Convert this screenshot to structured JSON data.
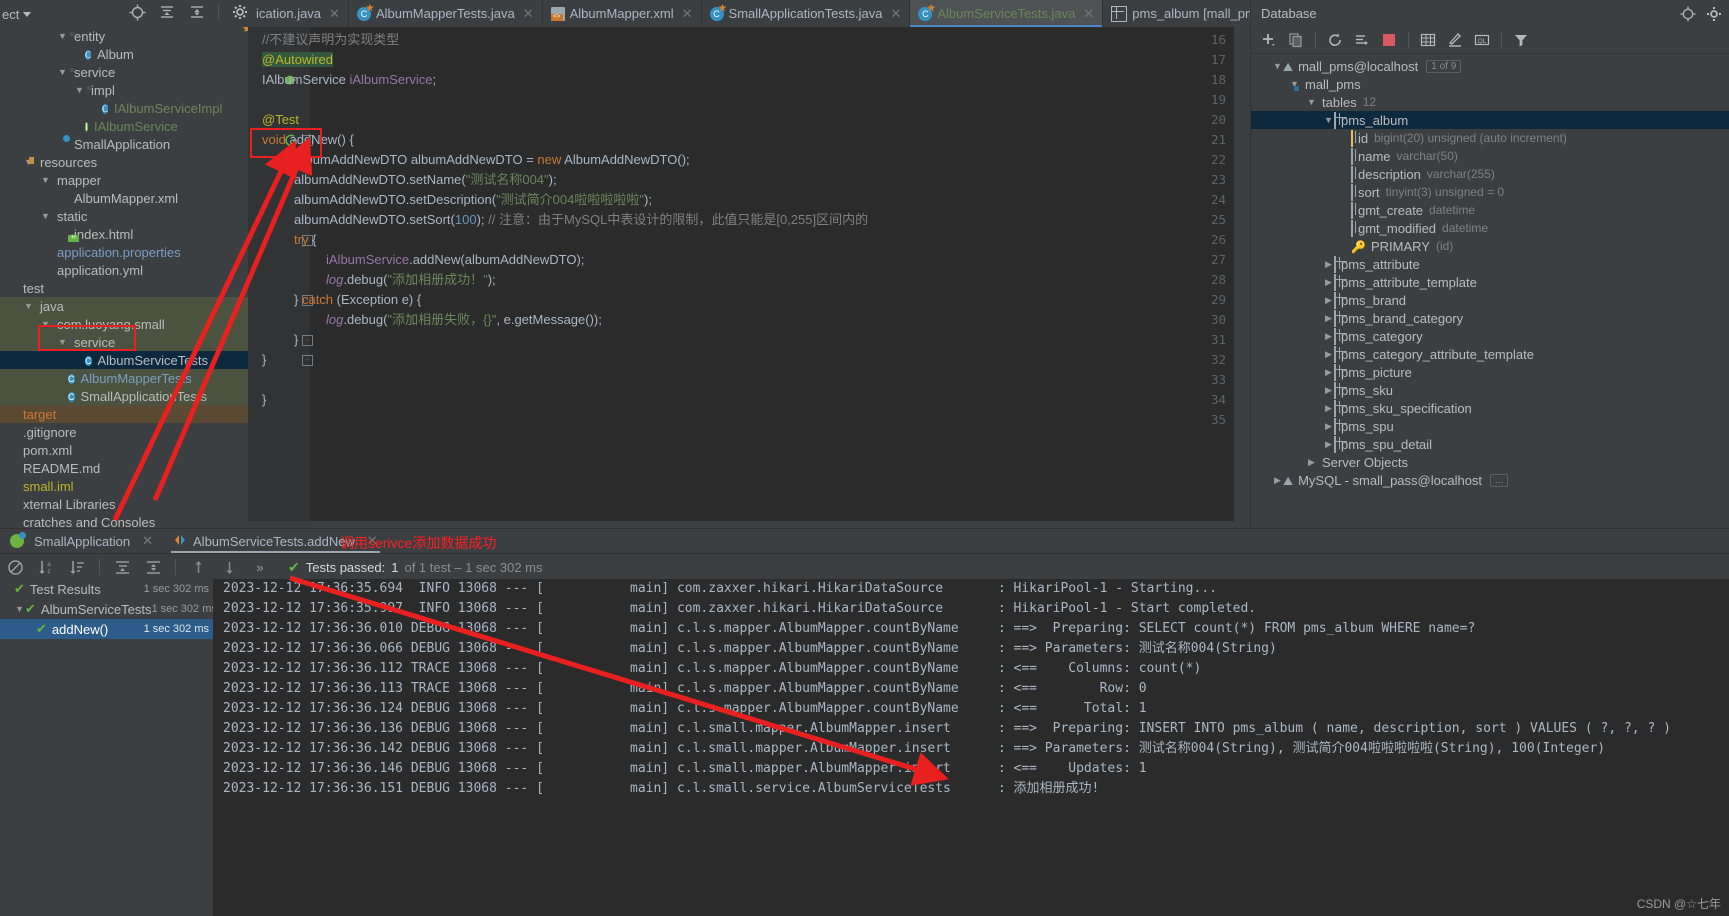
{
  "toolbar": {
    "project_label": "ect",
    "icons": [
      "locate-icon",
      "collapse-all-icon",
      "expand-all-icon",
      "gear-icon",
      "minimize-icon"
    ]
  },
  "editor_tabs": [
    {
      "label": "ication.java",
      "icon": "java-class-icon",
      "active": false,
      "color": "grey"
    },
    {
      "label": "AlbumMapperTests.java",
      "icon": "test-class-icon",
      "active": false,
      "color": "grey"
    },
    {
      "label": "AlbumMapper.xml",
      "icon": "xml-file-icon",
      "active": false,
      "color": "grey"
    },
    {
      "label": "SmallApplicationTests.java",
      "icon": "test-class-icon",
      "active": false,
      "color": "grey"
    },
    {
      "label": "AlbumServiceTests.java",
      "icon": "test-class-icon",
      "active": true,
      "color": "green"
    },
    {
      "label": "pms_album [mall_pms@localhost]",
      "icon": "db-table-icon",
      "active": false,
      "color": "grey"
    }
  ],
  "project_tree": [
    {
      "label": "entity",
      "indent": 3,
      "icon": "package-icon",
      "arrow": "down",
      "state": "normal",
      "clipped": true
    },
    {
      "label": "Album",
      "indent": 4,
      "icon": "class-icon",
      "arrow": "",
      "state": "normal"
    },
    {
      "label": "service",
      "indent": 3,
      "icon": "package-icon",
      "arrow": "down",
      "state": "normal"
    },
    {
      "label": "impl",
      "indent": 4,
      "icon": "package-icon",
      "arrow": "down",
      "state": "normal"
    },
    {
      "label": "IAlbumServiceImpl",
      "indent": 5,
      "icon": "class-icon",
      "arrow": "",
      "state": "green"
    },
    {
      "label": "IAlbumService",
      "indent": 4,
      "icon": "interface-icon",
      "arrow": "",
      "state": "green"
    },
    {
      "label": "SmallApplication",
      "indent": 3,
      "icon": "spring-icon",
      "arrow": "",
      "state": "normal"
    },
    {
      "label": "resources",
      "indent": 1,
      "icon": "resources-folder-icon",
      "arrow": "down",
      "state": "normal"
    },
    {
      "label": "mapper",
      "indent": 2,
      "icon": "folder-icon",
      "arrow": "down",
      "state": "normal"
    },
    {
      "label": "AlbumMapper.xml",
      "indent": 3,
      "icon": "xml-file-icon",
      "arrow": "",
      "state": "normal"
    },
    {
      "label": "static",
      "indent": 2,
      "icon": "folder-icon",
      "arrow": "down",
      "state": "normal"
    },
    {
      "label": "index.html",
      "indent": 3,
      "icon": "html-file-icon",
      "arrow": "",
      "state": "normal"
    },
    {
      "label": "application.properties",
      "indent": 2,
      "icon": "properties-icon",
      "arrow": "",
      "state": "blue"
    },
    {
      "label": "application.yml",
      "indent": 2,
      "icon": "properties-icon",
      "arrow": "",
      "state": "normal"
    },
    {
      "label": "test",
      "indent": 0,
      "icon": "folder-icon",
      "arrow": "",
      "state": "normal"
    },
    {
      "label": "java",
      "indent": 1,
      "icon": "test-source-folder-icon",
      "arrow": "down",
      "state": "testsrc"
    },
    {
      "label": "com.luoyang.small",
      "indent": 2,
      "icon": "package-icon",
      "arrow": "down",
      "state": "testsrc"
    },
    {
      "label": "service",
      "indent": 3,
      "icon": "package-icon",
      "arrow": "down",
      "state": "testsrc"
    },
    {
      "label": "AlbumServiceTests",
      "indent": 4,
      "icon": "test-class-icon",
      "arrow": "",
      "state": "selected"
    },
    {
      "label": "AlbumMapperTests",
      "indent": 3,
      "icon": "test-class-icon",
      "arrow": "",
      "state": "testsrc-blue"
    },
    {
      "label": "SmallApplicationTests",
      "indent": 3,
      "icon": "test-class-icon",
      "arrow": "",
      "state": "testsrc"
    },
    {
      "label": "target",
      "indent": 0,
      "icon": "target-folder-icon",
      "arrow": "",
      "state": "target"
    },
    {
      "label": ".gitignore",
      "indent": 0,
      "icon": "git-file-icon",
      "arrow": "",
      "state": "normal"
    },
    {
      "label": "pom.xml",
      "indent": 0,
      "icon": "maven-icon",
      "arrow": "",
      "state": "normal"
    },
    {
      "label": "README.md",
      "indent": 0,
      "icon": "markdown-icon",
      "arrow": "",
      "state": "normal"
    },
    {
      "label": "small.iml",
      "indent": 0,
      "icon": "iml-icon",
      "arrow": "",
      "state": "yellow"
    },
    {
      "label": "xternal Libraries",
      "indent": -1,
      "icon": "library-icon",
      "arrow": "",
      "state": "normal"
    },
    {
      "label": "cratches and Consoles",
      "indent": -1,
      "icon": "scratch-icon",
      "arrow": "",
      "state": "normal"
    }
  ],
  "editor": {
    "warning_count": "1",
    "warning_icon": "warning-triangle-icon",
    "first_line_number": 16,
    "lines": [
      {
        "n": 16,
        "html": "<span class='cmt'>//不建议声明为实现类型</span>",
        "indent": 0
      },
      {
        "n": 17,
        "html": "<span class='ann ann-hl'>@Autowired</span>",
        "indent": 0,
        "bulb": true,
        "caret": true
      },
      {
        "n": 18,
        "html": "<span class='typ'>IAlbumService</span> <span class='fld'>iAlbumService</span><span class='pln'>;</span>",
        "indent": 0,
        "impl_marker": true
      },
      {
        "n": 19,
        "html": "",
        "indent": 0
      },
      {
        "n": 20,
        "html": "<span class='ann'>@Test</span>",
        "indent": 0
      },
      {
        "n": 21,
        "html": "<span class='kw'>void</span> <span class='pln'>addNew() {</span>",
        "indent": 0,
        "run_marker": true,
        "fold": true
      },
      {
        "n": 22,
        "html": "<span class='typ'>AlbumAddNewDTO</span> <span class='pln'>albumAddNewDTO = </span><span class='kw'>new</span> <span class='typ'>AlbumAddNewDTO</span><span class='pln'>();</span>",
        "indent": 1
      },
      {
        "n": 23,
        "html": "<span class='pln'>albumAddNewDTO.setName(</span><span class='str'>\"测试名称004\"</span><span class='pln'>);</span>",
        "indent": 1
      },
      {
        "n": 24,
        "html": "<span class='pln'>albumAddNewDTO.setDescription(</span><span class='str'>\"测试简介004啦啦啦啦啦\"</span><span class='pln'>);</span>",
        "indent": 1
      },
      {
        "n": 25,
        "html": "<span class='pln'>albumAddNewDTO.setSort(</span><span class='num'>100</span><span class='pln'>);</span> <span class='cmt'>// 注意：由于MySQL中表设计的限制，此值只能是[0,255]区间内的</span>",
        "indent": 1
      },
      {
        "n": 26,
        "html": "<span class='kw'>try</span> <span class='pln'>{</span>",
        "indent": 1,
        "fold": true
      },
      {
        "n": 27,
        "html": "<span class='fld'>iAlbumService</span><span class='pln'>.addNew(albumAddNewDTO);</span>",
        "indent": 2
      },
      {
        "n": 28,
        "html": "<span class='ital'>log</span><span class='pln'>.debug(</span><span class='str'>\"添加相册成功！\"</span><span class='pln'>);</span>",
        "indent": 2
      },
      {
        "n": 29,
        "html": "<span class='pln'>} </span><span class='kw'>catch</span> <span class='pln'>(Exception e) {</span>",
        "indent": 1,
        "fold": true
      },
      {
        "n": 30,
        "html": "<span class='ital'>log</span><span class='pln'>.debug(</span><span class='str'>\"添加相册失败，{}\"</span><span class='pln'>, e.getMessage());</span>",
        "indent": 2
      },
      {
        "n": 31,
        "html": "<span class='pln'>}</span>",
        "indent": 1,
        "fold": true
      },
      {
        "n": 32,
        "html": "<span class='pln'>}</span>",
        "indent": 0,
        "fold": true
      },
      {
        "n": 33,
        "html": "",
        "indent": 0
      },
      {
        "n": 34,
        "html": "<span class='pln'>}</span>",
        "indent": -1
      },
      {
        "n": 35,
        "html": "",
        "indent": 0
      }
    ]
  },
  "database": {
    "title": "Database",
    "header_icons": [
      "locate-icon",
      "settings-icon"
    ],
    "toolbar_icons": [
      "add-icon",
      "copy-icon",
      "refresh-icon",
      "sync-icon",
      "stop-icon",
      "table-icon",
      "modify-icon",
      "sql-console-icon",
      "filter-icon"
    ],
    "tree": [
      {
        "label": "mall_pms@localhost",
        "type": "",
        "indent": 1,
        "icon": "connection-icon",
        "arrow": "down",
        "badge": "1 of 9",
        "state": "normal"
      },
      {
        "label": "mall_pms",
        "type": "",
        "indent": 2,
        "icon": "schema-icon",
        "arrow": "down",
        "state": "normal"
      },
      {
        "label": "tables",
        "type": "12",
        "indent": 3,
        "icon": "folder-icon",
        "arrow": "down",
        "state": "normal"
      },
      {
        "label": "pms_album",
        "type": "",
        "indent": 4,
        "icon": "table-icon",
        "arrow": "down",
        "state": "selected"
      },
      {
        "label": "id",
        "type": "bigint(20) unsigned (auto increment)",
        "indent": 5,
        "icon": "pk-column-icon",
        "arrow": "",
        "state": "normal"
      },
      {
        "label": "name",
        "type": "varchar(50)",
        "indent": 5,
        "icon": "column-icon",
        "arrow": "",
        "state": "normal"
      },
      {
        "label": "description",
        "type": "varchar(255)",
        "indent": 5,
        "icon": "column-icon",
        "arrow": "",
        "state": "normal"
      },
      {
        "label": "sort",
        "type": "tinyint(3) unsigned = 0",
        "indent": 5,
        "icon": "column-icon",
        "arrow": "",
        "state": "normal"
      },
      {
        "label": "gmt_create",
        "type": "datetime",
        "indent": 5,
        "icon": "column-icon",
        "arrow": "",
        "state": "normal"
      },
      {
        "label": "gmt_modified",
        "type": "datetime",
        "indent": 5,
        "icon": "column-icon",
        "arrow": "",
        "state": "normal"
      },
      {
        "label": "PRIMARY",
        "type": "(id)",
        "indent": 5,
        "icon": "key-icon",
        "arrow": "",
        "state": "normal"
      },
      {
        "label": "pms_attribute",
        "type": "",
        "indent": 4,
        "icon": "table-icon",
        "arrow": "right",
        "state": "normal"
      },
      {
        "label": "pms_attribute_template",
        "type": "",
        "indent": 4,
        "icon": "table-icon",
        "arrow": "right",
        "state": "normal"
      },
      {
        "label": "pms_brand",
        "type": "",
        "indent": 4,
        "icon": "table-icon",
        "arrow": "right",
        "state": "normal"
      },
      {
        "label": "pms_brand_category",
        "type": "",
        "indent": 4,
        "icon": "table-icon",
        "arrow": "right",
        "state": "normal"
      },
      {
        "label": "pms_category",
        "type": "",
        "indent": 4,
        "icon": "table-icon",
        "arrow": "right",
        "state": "normal"
      },
      {
        "label": "pms_category_attribute_template",
        "type": "",
        "indent": 4,
        "icon": "table-icon",
        "arrow": "right",
        "state": "normal"
      },
      {
        "label": "pms_picture",
        "type": "",
        "indent": 4,
        "icon": "table-icon",
        "arrow": "right",
        "state": "normal"
      },
      {
        "label": "pms_sku",
        "type": "",
        "indent": 4,
        "icon": "table-icon",
        "arrow": "right",
        "state": "normal"
      },
      {
        "label": "pms_sku_specification",
        "type": "",
        "indent": 4,
        "icon": "table-icon",
        "arrow": "right",
        "state": "normal"
      },
      {
        "label": "pms_spu",
        "type": "",
        "indent": 4,
        "icon": "table-icon",
        "arrow": "right",
        "state": "normal"
      },
      {
        "label": "pms_spu_detail",
        "type": "",
        "indent": 4,
        "icon": "table-icon",
        "arrow": "right",
        "state": "normal"
      },
      {
        "label": "Server Objects",
        "type": "",
        "indent": 3,
        "icon": "folder-icon",
        "arrow": "right",
        "state": "normal"
      },
      {
        "label": "MySQL - small_pass@localhost",
        "type": "",
        "indent": 1,
        "icon": "connection-icon",
        "arrow": "right",
        "badge": "...",
        "state": "normal"
      }
    ]
  },
  "run_panel": {
    "tabs": [
      {
        "label": "SmallApplication",
        "icon": "spring-icon",
        "active": false
      },
      {
        "label": "AlbumServiceTests.addNew",
        "icon": "run-test-icon",
        "active": true
      }
    ],
    "toolbar_icons": [
      "suppress-icon",
      "sort-alpha-icon",
      "sort-duration-icon",
      "collapse-icon",
      "expand-icon",
      "prev-test-icon",
      "next-test-icon",
      "more-icon"
    ],
    "status": {
      "check_icon": "check-icon",
      "label": "Tests passed:",
      "count": "1",
      "suffix": "of 1 test – 1 sec 302 ms"
    },
    "test_tree": [
      {
        "label": "Test Results",
        "icon": "check-icon",
        "time": "1 sec 302 ms",
        "indent": 0,
        "state": "normal",
        "arrow": ""
      },
      {
        "label": "AlbumServiceTests",
        "icon": "check-icon",
        "time": "1 sec 302 ms",
        "indent": 1,
        "state": "normal",
        "arrow": "down"
      },
      {
        "label": "addNew()",
        "icon": "check-icon",
        "time": "1 sec 302 ms",
        "indent": 2,
        "state": "selected",
        "arrow": ""
      }
    ],
    "console_lines": [
      "2023-12-12 17:36:35.694  INFO 13068 --- [           main] com.zaxxer.hikari.HikariDataSource       : HikariPool-1 - Starting...",
      "2023-12-12 17:36:35.997  INFO 13068 --- [           main] com.zaxxer.hikari.HikariDataSource       : HikariPool-1 - Start completed.",
      "2023-12-12 17:36:36.010 DEBUG 13068 --- [           main] c.l.s.mapper.AlbumMapper.countByName     : ==>  Preparing: SELECT count(*) FROM pms_album WHERE name=?",
      "2023-12-12 17:36:36.066 DEBUG 13068 --- [           main] c.l.s.mapper.AlbumMapper.countByName     : ==> Parameters: 测试名称004(String)",
      "2023-12-12 17:36:36.112 TRACE 13068 --- [           main] c.l.s.mapper.AlbumMapper.countByName     : <==    Columns: count(*)",
      "2023-12-12 17:36:36.113 TRACE 13068 --- [           main] c.l.s.mapper.AlbumMapper.countByName     : <==        Row: 0",
      "2023-12-12 17:36:36.124 DEBUG 13068 --- [           main] c.l.s.mapper.AlbumMapper.countByName     : <==      Total: 1",
      "2023-12-12 17:36:36.136 DEBUG 13068 --- [           main] c.l.small.mapper.AlbumMapper.insert      : ==>  Preparing: INSERT INTO pms_album ( name, description, sort ) VALUES ( ?, ?, ? )",
      "2023-12-12 17:36:36.142 DEBUG 13068 --- [           main] c.l.small.mapper.AlbumMapper.insert      : ==> Parameters: 测试名称004(String), 测试简介004啦啦啦啦啦(String), 100(Integer)",
      "2023-12-12 17:36:36.146 DEBUG 13068 --- [           main] c.l.small.mapper.AlbumMapper.insert      : <==    Updates: 1",
      "2023-12-12 17:36:36.151 DEBUG 13068 --- [           main] c.l.small.service.AlbumServiceTests      : 添加相册成功!"
    ]
  },
  "annotations": {
    "callout_text": "调用serivce添加数据成功",
    "color": "#ff1f1f"
  },
  "watermark": "CSDN @☆七年"
}
